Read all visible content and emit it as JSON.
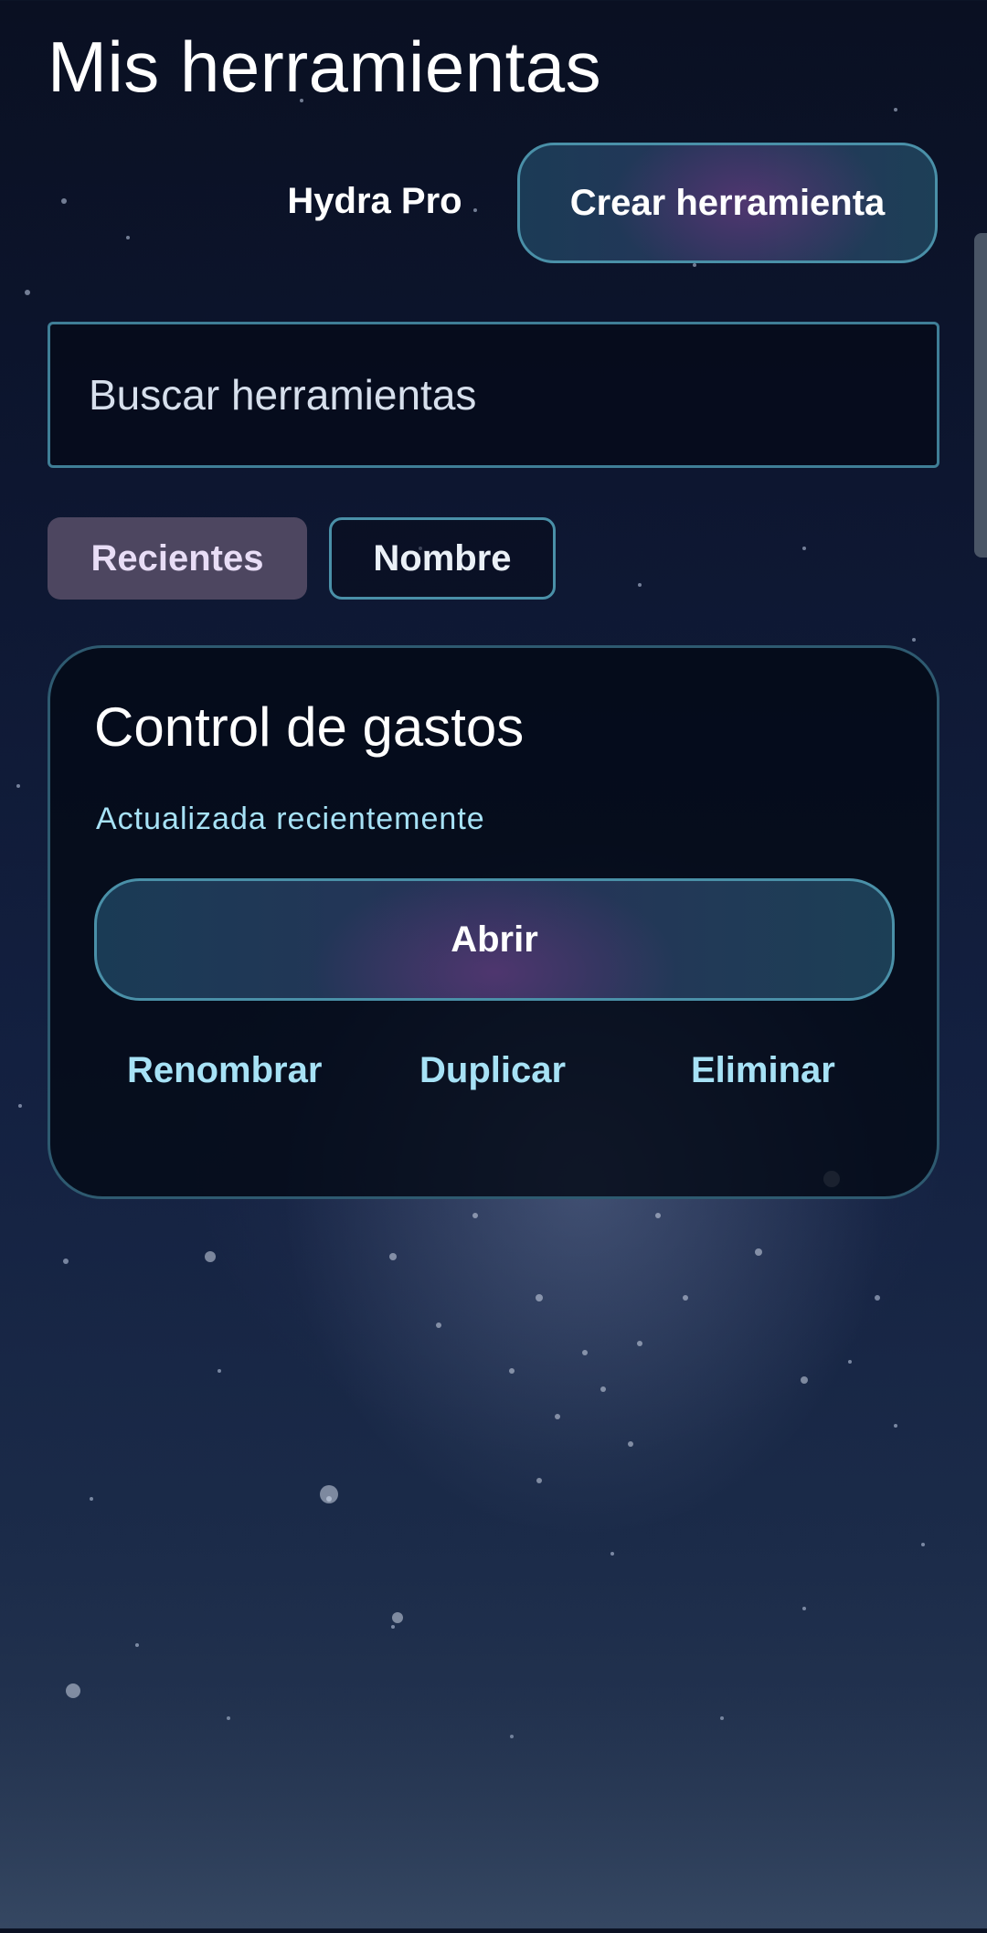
{
  "header": {
    "title": "Mis herramientas",
    "plan_label": "Hydra Pro",
    "create_button_label": "Crear herramienta"
  },
  "search": {
    "placeholder": "Buscar herramientas",
    "value": ""
  },
  "sort_chips": [
    {
      "label": "Recientes",
      "selected": true
    },
    {
      "label": "Nombre",
      "selected": false
    }
  ],
  "tools": [
    {
      "name": "Control de gastos",
      "status": "Actualizada recientemente",
      "open_label": "Abrir",
      "actions": {
        "rename": "Renombrar",
        "duplicate": "Duplicar",
        "delete": "Eliminar"
      }
    }
  ],
  "colors": {
    "accent_border": "#4a90a8",
    "link_text": "#a7e2f6",
    "selected_chip_bg": "#4d4660",
    "background_top": "#0a1022"
  }
}
